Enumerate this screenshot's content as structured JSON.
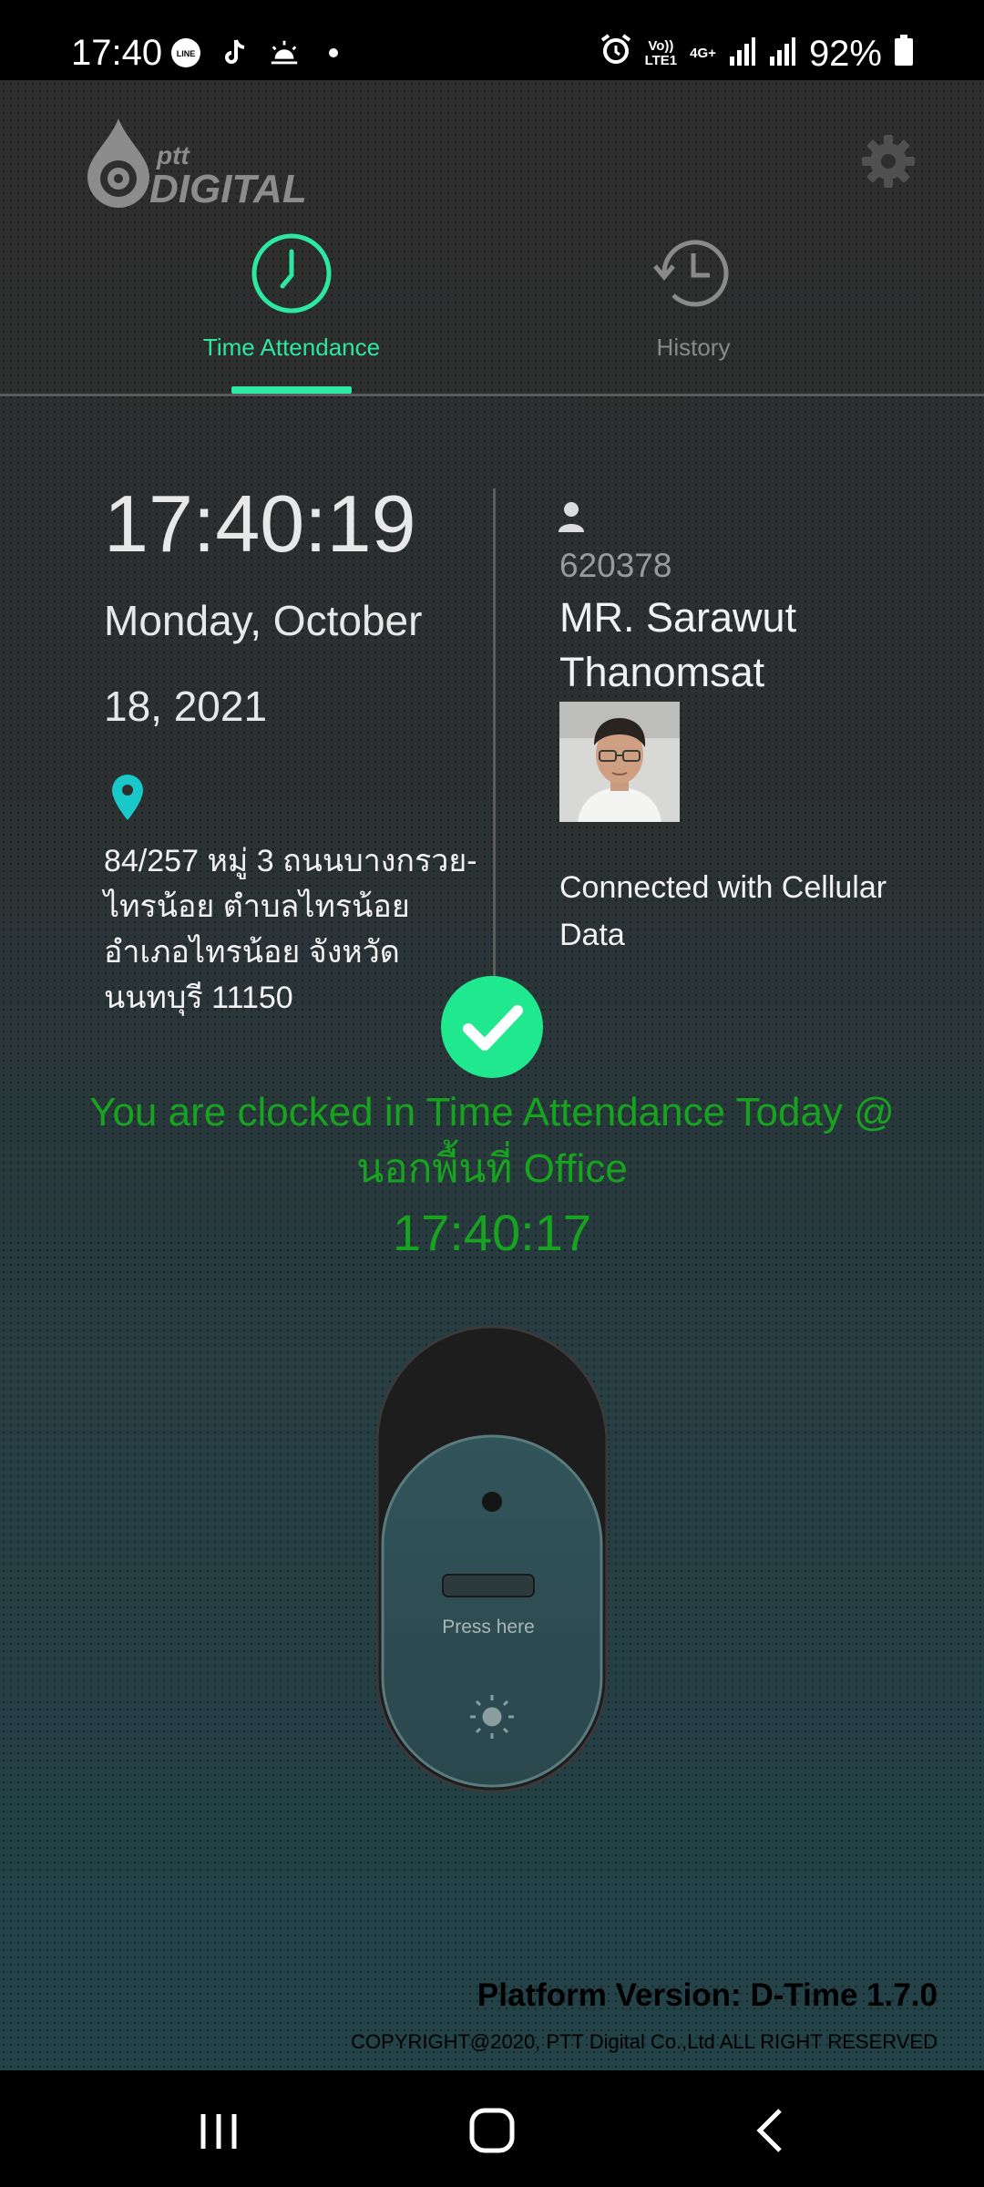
{
  "status_bar": {
    "time": "17:40",
    "battery": "92%",
    "net_top": "Vo))",
    "net_bottom": "LTE1",
    "net_type": "4G+",
    "icons": [
      "line-icon",
      "tiktok-icon",
      "weather-icon",
      "dot-icon",
      "alarm-icon",
      "signal-icon",
      "signal-icon",
      "battery-icon"
    ]
  },
  "header": {
    "logo_text_small": "ptt",
    "logo_text_large": "DIGITAL",
    "settings_icon": "gear-icon"
  },
  "tabs": [
    {
      "label": "Time Attendance",
      "icon": "clock-icon",
      "active": true
    },
    {
      "label": "History",
      "icon": "history-icon",
      "active": false
    }
  ],
  "colors": {
    "accent": "#2de8a3",
    "success": "#17a31f",
    "location": "#19c8c8"
  },
  "attendance": {
    "current_time": "17:40:19",
    "date_line1": "Monday, October",
    "date_line2": "18, 2021",
    "address": "84/257 หมู่ 3 ถนนบางกรวย-ไทรน้อย ตำบลไทรน้อย อำเภอไทรน้อย จังหวัดนนทบุรี 11150"
  },
  "user": {
    "employee_id": "620378",
    "name": "MR. Sarawut Thanomsat",
    "connection": "Connected with Cellular Data"
  },
  "result": {
    "message": "You are clocked in Time Attendance Today @ นอกพื้นที่ Office",
    "time": "17:40:17"
  },
  "press_button": {
    "label": "Press here"
  },
  "footer": {
    "version": "Platform Version: D-Time 1.7.0",
    "copyright": "COPYRIGHT@2020, PTT Digital Co.,Ltd ALL RIGHT RESERVED"
  },
  "navbar": [
    "recent-apps-icon",
    "home-icon",
    "back-icon"
  ]
}
